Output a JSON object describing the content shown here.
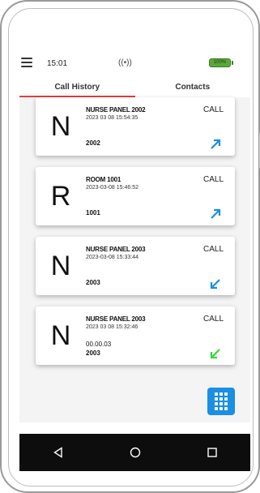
{
  "status": {
    "time": "15:01",
    "signal": "((•))",
    "battery": "100%"
  },
  "tabs": [
    {
      "label": "Call History",
      "active": true
    },
    {
      "label": "Contacts",
      "active": false
    }
  ],
  "calls": [
    {
      "initial": "N",
      "name": "NURSE PANEL 2002",
      "timestamp": "2023 03 08 15:54:35",
      "duration": "",
      "number": "2002",
      "type": "CALL",
      "direction": "outgoing"
    },
    {
      "initial": "R",
      "name": "ROOM 1001",
      "timestamp": "2023-03-08 15:46:52",
      "duration": "",
      "number": "1001",
      "type": "CALL",
      "direction": "outgoing"
    },
    {
      "initial": "N",
      "name": "NURSE PANEL 2003",
      "timestamp": "2023-03-08 15:33:44",
      "duration": "",
      "number": "2003",
      "type": "CALL",
      "direction": "incoming"
    },
    {
      "initial": "N",
      "name": "NURSE PANEL 2003",
      "timestamp": "2023 03 08 15:32:46",
      "duration": "00.00.03",
      "number": "2003",
      "type": "CALL",
      "direction": "answered"
    }
  ],
  "colors": {
    "outgoing": "#1a8fe3",
    "incoming": "#1a8fe3",
    "answered": "#3ad63a",
    "tab_indicator": "#e04040",
    "fab": "#1a8fe3"
  },
  "icons": {
    "menu": "menu-icon",
    "dialpad": "dialpad-icon",
    "back": "back-icon",
    "home": "home-icon",
    "recents": "recents-icon"
  }
}
